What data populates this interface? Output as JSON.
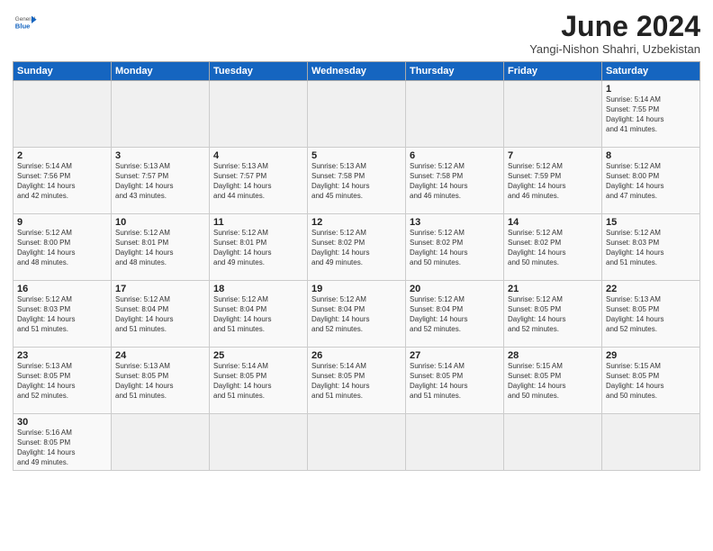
{
  "logo": {
    "general": "General",
    "blue": "Blue"
  },
  "title": "June 2024",
  "location": "Yangi-Nishon Shahri, Uzbekistan",
  "days_header": [
    "Sunday",
    "Monday",
    "Tuesday",
    "Wednesday",
    "Thursday",
    "Friday",
    "Saturday"
  ],
  "weeks": [
    [
      {
        "num": "",
        "info": ""
      },
      {
        "num": "",
        "info": ""
      },
      {
        "num": "",
        "info": ""
      },
      {
        "num": "",
        "info": ""
      },
      {
        "num": "",
        "info": ""
      },
      {
        "num": "",
        "info": ""
      },
      {
        "num": "1",
        "info": "Sunrise: 5:14 AM\nSunset: 7:55 PM\nDaylight: 14 hours\nand 41 minutes."
      }
    ],
    [
      {
        "num": "2",
        "info": "Sunrise: 5:14 AM\nSunset: 7:56 PM\nDaylight: 14 hours\nand 42 minutes."
      },
      {
        "num": "3",
        "info": "Sunrise: 5:13 AM\nSunset: 7:57 PM\nDaylight: 14 hours\nand 43 minutes."
      },
      {
        "num": "4",
        "info": "Sunrise: 5:13 AM\nSunset: 7:57 PM\nDaylight: 14 hours\nand 44 minutes."
      },
      {
        "num": "5",
        "info": "Sunrise: 5:13 AM\nSunset: 7:58 PM\nDaylight: 14 hours\nand 45 minutes."
      },
      {
        "num": "6",
        "info": "Sunrise: 5:12 AM\nSunset: 7:58 PM\nDaylight: 14 hours\nand 46 minutes."
      },
      {
        "num": "7",
        "info": "Sunrise: 5:12 AM\nSunset: 7:59 PM\nDaylight: 14 hours\nand 46 minutes."
      },
      {
        "num": "8",
        "info": "Sunrise: 5:12 AM\nSunset: 8:00 PM\nDaylight: 14 hours\nand 47 minutes."
      }
    ],
    [
      {
        "num": "9",
        "info": "Sunrise: 5:12 AM\nSunset: 8:00 PM\nDaylight: 14 hours\nand 48 minutes."
      },
      {
        "num": "10",
        "info": "Sunrise: 5:12 AM\nSunset: 8:01 PM\nDaylight: 14 hours\nand 48 minutes."
      },
      {
        "num": "11",
        "info": "Sunrise: 5:12 AM\nSunset: 8:01 PM\nDaylight: 14 hours\nand 49 minutes."
      },
      {
        "num": "12",
        "info": "Sunrise: 5:12 AM\nSunset: 8:02 PM\nDaylight: 14 hours\nand 49 minutes."
      },
      {
        "num": "13",
        "info": "Sunrise: 5:12 AM\nSunset: 8:02 PM\nDaylight: 14 hours\nand 50 minutes."
      },
      {
        "num": "14",
        "info": "Sunrise: 5:12 AM\nSunset: 8:02 PM\nDaylight: 14 hours\nand 50 minutes."
      },
      {
        "num": "15",
        "info": "Sunrise: 5:12 AM\nSunset: 8:03 PM\nDaylight: 14 hours\nand 51 minutes."
      }
    ],
    [
      {
        "num": "16",
        "info": "Sunrise: 5:12 AM\nSunset: 8:03 PM\nDaylight: 14 hours\nand 51 minutes."
      },
      {
        "num": "17",
        "info": "Sunrise: 5:12 AM\nSunset: 8:04 PM\nDaylight: 14 hours\nand 51 minutes."
      },
      {
        "num": "18",
        "info": "Sunrise: 5:12 AM\nSunset: 8:04 PM\nDaylight: 14 hours\nand 51 minutes."
      },
      {
        "num": "19",
        "info": "Sunrise: 5:12 AM\nSunset: 8:04 PM\nDaylight: 14 hours\nand 52 minutes."
      },
      {
        "num": "20",
        "info": "Sunrise: 5:12 AM\nSunset: 8:04 PM\nDaylight: 14 hours\nand 52 minutes."
      },
      {
        "num": "21",
        "info": "Sunrise: 5:12 AM\nSunset: 8:05 PM\nDaylight: 14 hours\nand 52 minutes."
      },
      {
        "num": "22",
        "info": "Sunrise: 5:13 AM\nSunset: 8:05 PM\nDaylight: 14 hours\nand 52 minutes."
      }
    ],
    [
      {
        "num": "23",
        "info": "Sunrise: 5:13 AM\nSunset: 8:05 PM\nDaylight: 14 hours\nand 52 minutes."
      },
      {
        "num": "24",
        "info": "Sunrise: 5:13 AM\nSunset: 8:05 PM\nDaylight: 14 hours\nand 51 minutes."
      },
      {
        "num": "25",
        "info": "Sunrise: 5:14 AM\nSunset: 8:05 PM\nDaylight: 14 hours\nand 51 minutes."
      },
      {
        "num": "26",
        "info": "Sunrise: 5:14 AM\nSunset: 8:05 PM\nDaylight: 14 hours\nand 51 minutes."
      },
      {
        "num": "27",
        "info": "Sunrise: 5:14 AM\nSunset: 8:05 PM\nDaylight: 14 hours\nand 51 minutes."
      },
      {
        "num": "28",
        "info": "Sunrise: 5:15 AM\nSunset: 8:05 PM\nDaylight: 14 hours\nand 50 minutes."
      },
      {
        "num": "29",
        "info": "Sunrise: 5:15 AM\nSunset: 8:05 PM\nDaylight: 14 hours\nand 50 minutes."
      }
    ],
    [
      {
        "num": "30",
        "info": "Sunrise: 5:16 AM\nSunset: 8:05 PM\nDaylight: 14 hours\nand 49 minutes."
      },
      {
        "num": "",
        "info": ""
      },
      {
        "num": "",
        "info": ""
      },
      {
        "num": "",
        "info": ""
      },
      {
        "num": "",
        "info": ""
      },
      {
        "num": "",
        "info": ""
      },
      {
        "num": "",
        "info": ""
      }
    ]
  ]
}
